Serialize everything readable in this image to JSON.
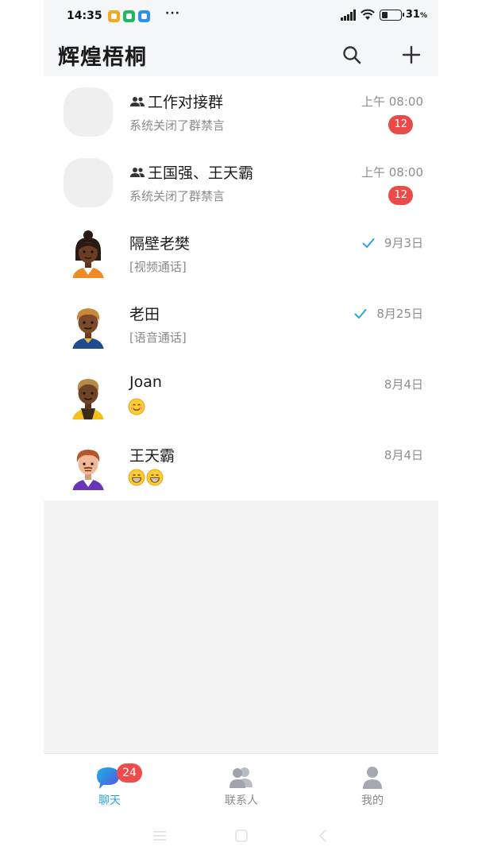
{
  "status_bar": {
    "time": "14:35",
    "dots": "···",
    "battery_percent": "31",
    "battery_unit": "%",
    "battery_level": 0.31,
    "app_icons": [
      {
        "name": "orange-app-icon",
        "color": "#f5a623"
      },
      {
        "name": "green-app-icon",
        "color": "#1fb860"
      },
      {
        "name": "blue-app-icon",
        "color": "#2f8ff0"
      }
    ]
  },
  "header": {
    "title": "辉煌梧桐",
    "search_icon": "search-icon",
    "add_icon": "plus-icon"
  },
  "chats": [
    {
      "name": "工作对接群",
      "is_group": true,
      "last_message": "系统关闭了群禁言",
      "time": "上午 08:00",
      "unread": "12"
    },
    {
      "name": "王国强、王天霸",
      "is_group": true,
      "last_message": "系统关闭了群禁言",
      "time": "上午 08:00",
      "unread": "12"
    },
    {
      "name": "隔壁老樊",
      "is_group": false,
      "last_message": "[视频通话]",
      "time": "9月3日",
      "read_check": true
    },
    {
      "name": "老田",
      "is_group": false,
      "last_message": "[语音通话]",
      "time": "8月25日",
      "read_check": true
    },
    {
      "name": "Joan",
      "is_group": false,
      "last_message_emoji": [
        "smile"
      ],
      "time": "8月4日"
    },
    {
      "name": "王天霸",
      "is_group": false,
      "last_message_emoji": [
        "grin",
        "grin"
      ],
      "time": "8月4日"
    }
  ],
  "tabs": [
    {
      "label": "聊天",
      "icon": "chat-bubble-icon",
      "badge": "24",
      "active": true
    },
    {
      "label": "联系人",
      "icon": "contacts-icon",
      "active": false
    },
    {
      "label": "我的",
      "icon": "person-icon",
      "active": false
    }
  ],
  "colors": {
    "accent": "#2aa4d8",
    "badge": "#ea4a4a",
    "check": "#2aa4d8"
  }
}
